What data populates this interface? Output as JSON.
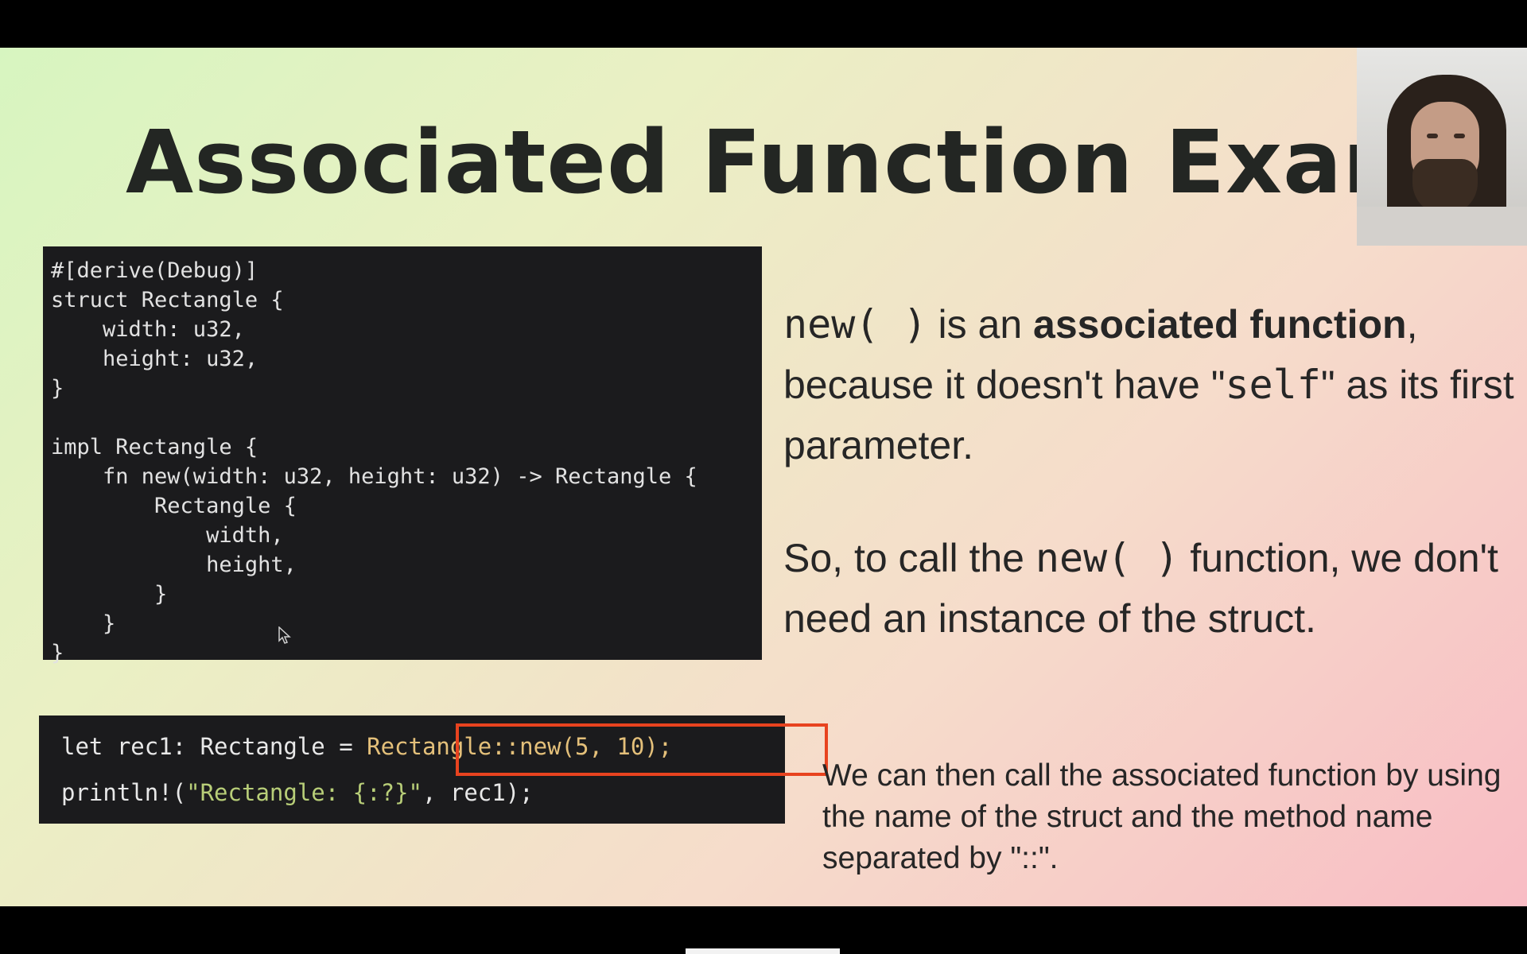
{
  "slide": {
    "title": "Associated Function Exampl",
    "code_block": {
      "lines": [
        "#[derive(Debug)]",
        "struct Rectangle {",
        "    width: u32,",
        "    height: u32,",
        "}",
        "",
        "impl Rectangle {",
        "    fn new(width: u32, height: u32) -> Rectangle {",
        "        Rectangle {",
        "            width,",
        "            height,",
        "        }",
        "    }",
        "}"
      ]
    },
    "call_block": {
      "line1_prefix": "let rec1: Rectangle = ",
      "line1_highlight": "Rectangle::new(5, 10);",
      "line2_prefix": "println!(",
      "line2_string": "\"Rectangle: {:?}\"",
      "line2_suffix": ", rec1);"
    },
    "paragraph1": {
      "code": "new( )",
      "text_a": " is an ",
      "bold": "associated function",
      "text_b": ", because it doesn't have \"",
      "code2": "self",
      "text_c": "\" as its first parameter."
    },
    "paragraph2": {
      "text_a": "So, to call the ",
      "code": "new( )",
      "text_b": " function, we don't need an instance of the struct."
    },
    "paragraph3": "We can then call the associated function by using the name of the struct and the method name separated by \"::\"."
  },
  "colors": {
    "highlight_border": "#e8431f",
    "code_background": "#1b1b1d"
  }
}
